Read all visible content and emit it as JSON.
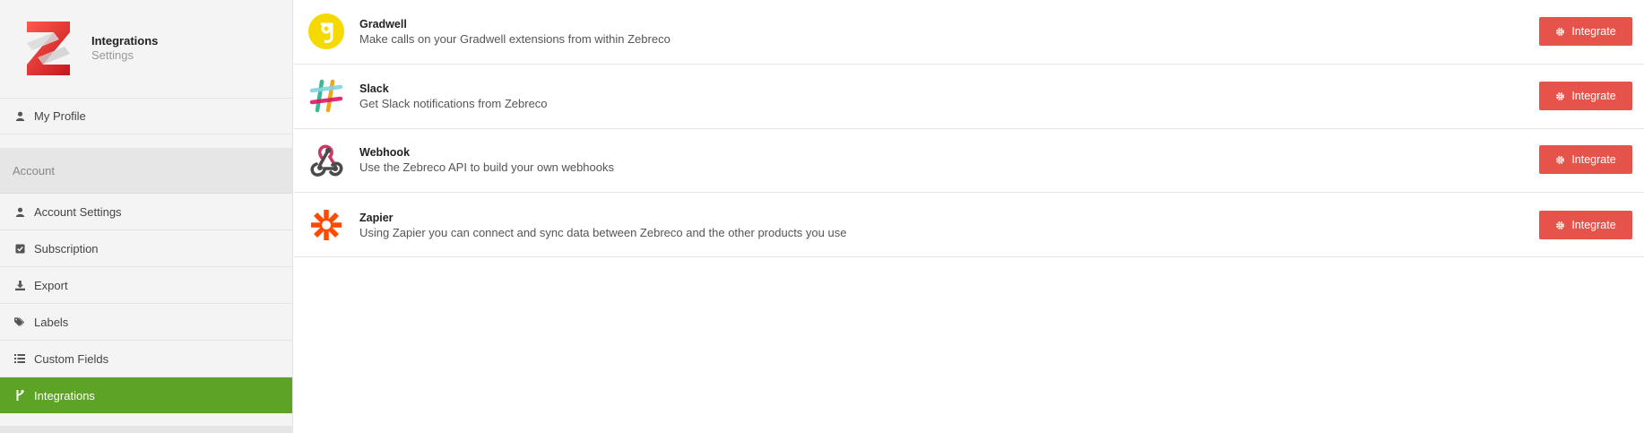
{
  "brand": {
    "title": "Integrations",
    "subtitle": "Settings"
  },
  "sidebar": {
    "profile_label": "My Profile",
    "section_label": "Account",
    "items": [
      {
        "label": "Account Settings",
        "icon": "user-icon"
      },
      {
        "label": "Subscription",
        "icon": "check-square-icon"
      },
      {
        "label": "Export",
        "icon": "download-icon"
      },
      {
        "label": "Labels",
        "icon": "tags-icon"
      },
      {
        "label": "Custom Fields",
        "icon": "list-icon"
      },
      {
        "label": "Integrations",
        "icon": "code-fork-icon",
        "active": true
      }
    ]
  },
  "integrations": [
    {
      "name": "Gradwell",
      "description": "Make calls on your Gradwell extensions from within Zebreco",
      "button": "Integrate",
      "icon": "gradwell-logo"
    },
    {
      "name": "Slack",
      "description": "Get Slack notifications from Zebreco",
      "button": "Integrate",
      "icon": "slack-logo"
    },
    {
      "name": "Webhook",
      "description": "Use the Zebreco API to build your own webhooks",
      "button": "Integrate",
      "icon": "webhook-logo"
    },
    {
      "name": "Zapier",
      "description": "Using Zapier you can connect and sync data between Zebreco and the other products you use",
      "button": "Integrate",
      "icon": "zapier-logo"
    }
  ],
  "colors": {
    "active_nav": "#5da325",
    "button": "#e5534b",
    "zapier": "#ff4a00",
    "gradwell": "#f6d900"
  }
}
